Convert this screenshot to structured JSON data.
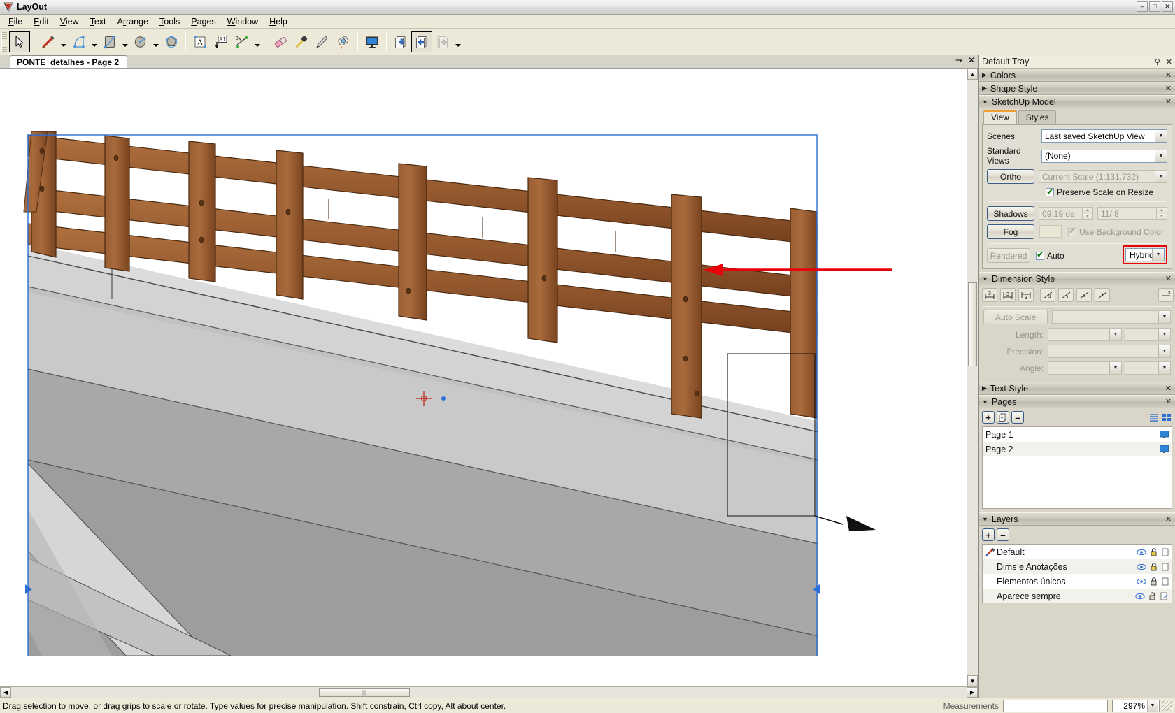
{
  "window": {
    "title": "LayOut",
    "app_icon": "layout-logo-icon",
    "minimize": "–",
    "maximize": "□",
    "close": "✕"
  },
  "menu": [
    {
      "label": "File",
      "accel": "F"
    },
    {
      "label": "Edit",
      "accel": "E"
    },
    {
      "label": "View",
      "accel": "V"
    },
    {
      "label": "Text",
      "accel": "T"
    },
    {
      "label": "Arrange",
      "accel": "A"
    },
    {
      "label": "Tools",
      "accel": "T"
    },
    {
      "label": "Pages",
      "accel": "P"
    },
    {
      "label": "Window",
      "accel": "W"
    },
    {
      "label": "Help",
      "accel": "H"
    }
  ],
  "toolbar": {
    "tools": [
      {
        "name": "select-tool",
        "icon": "cursor-arrow-icon",
        "active": true
      },
      {
        "name": "pencil-tool",
        "icon": "pencil-icon",
        "dropdown": true
      },
      {
        "name": "arc-tool",
        "icon": "arc-icon",
        "dropdown": true
      },
      {
        "name": "rectangle-tool",
        "icon": "rectangle-icon",
        "dropdown": true
      },
      {
        "name": "circle-tool",
        "icon": "circle-icon",
        "dropdown": true
      },
      {
        "name": "polygon-tool",
        "icon": "polygon-icon",
        "dropdown": false
      },
      {
        "name": "text-tool",
        "icon": "text-a-icon"
      },
      {
        "name": "label-tool",
        "icon": "label-a1-icon"
      },
      {
        "name": "dimension-tool",
        "icon": "dimension-icon",
        "dropdown": true
      },
      {
        "name": "eraser-tool",
        "icon": "eraser-icon"
      },
      {
        "name": "eyedropper-tool",
        "icon": "eyedropper-icon"
      },
      {
        "name": "style-tool",
        "icon": "pen-nib-icon"
      },
      {
        "name": "paint-tool",
        "icon": "paint-bucket-icon"
      },
      {
        "name": "presentation-tool",
        "icon": "monitor-icon"
      },
      {
        "name": "add-page",
        "icon": "page-add-icon"
      },
      {
        "name": "previous-page",
        "icon": "page-previous-icon",
        "active": true
      },
      {
        "name": "next-page",
        "icon": "page-next-icon",
        "disabled": true
      }
    ]
  },
  "document": {
    "tab_label": "PONTE_detalhes - Page 2",
    "zoom": "297%"
  },
  "tray": {
    "title": "Default Tray",
    "pin_icon": "pin-icon",
    "close_icon": "close-icon",
    "panels": [
      {
        "name": "colors",
        "label": "Colors",
        "expanded": false
      },
      {
        "name": "shape-style",
        "label": "Shape Style",
        "expanded": false
      },
      {
        "name": "sketchup-model",
        "label": "SketchUp Model",
        "expanded": true
      },
      {
        "name": "dimension-style",
        "label": "Dimension Style",
        "expanded": true
      },
      {
        "name": "text-style",
        "label": "Text Style",
        "expanded": false
      },
      {
        "name": "pages",
        "label": "Pages",
        "expanded": true
      },
      {
        "name": "layers",
        "label": "Layers",
        "expanded": true
      }
    ]
  },
  "sketchup_model": {
    "tabs": [
      {
        "label": "View",
        "active": true
      },
      {
        "label": "Styles",
        "active": false
      }
    ],
    "scenes_label": "Scenes",
    "scenes_value": "Last saved SketchUp View",
    "standard_views_label": "Standard Views",
    "standard_views_value": "(None)",
    "ortho_button": "Ortho",
    "current_scale_value": "Current Scale (1:131.732)",
    "preserve_scale_label": "Preserve Scale on Resize",
    "preserve_scale_checked": true,
    "shadows_button": "Shadows",
    "shadows_time": "09:19 de.",
    "shadows_date": "11/  8",
    "fog_button": "Fog",
    "use_background_label": "Use Background Color",
    "use_background_checked": true,
    "rendered_button": "Rendered",
    "auto_label": "Auto",
    "auto_checked": true,
    "render_mode_value": "Hybrid",
    "highlight_color": "#e8000a"
  },
  "dimension_style": {
    "align_icons": [
      "dim-align-above-icon",
      "dim-align-center-icon",
      "dim-align-below-icon",
      "dim-rotate-horizontal-icon",
      "dim-rotate-aligned-icon",
      "dim-rotate-vertical-icon",
      "dim-rotate-perpendicular-icon",
      "dim-start-arrow-icon"
    ],
    "auto_scale_button": "Auto Scale",
    "length_label": "Length:",
    "precision_label": "Precision:",
    "angle_label": "Angle:"
  },
  "pages": {
    "add_icon": "plus-icon",
    "duplicate_icon": "duplicate-page-icon",
    "remove_icon": "minus-icon",
    "list_view_icon": "list-view-icon",
    "grid_view_icon": "grid-view-icon",
    "items": [
      {
        "name": "Page 1",
        "monitor_icon": "monitor-icon"
      },
      {
        "name": "Page 2",
        "monitor_icon": "monitor-icon"
      }
    ]
  },
  "layers": {
    "add_icon": "plus-icon",
    "remove_icon": "minus-icon",
    "items": [
      {
        "name": "Default",
        "active": true,
        "pencil_icon": "pencil-active-icon",
        "visible_icon": "eye-icon",
        "lock_icon": "unlock-icon",
        "shared_icon": "page-icon"
      },
      {
        "name": "Dims e Anotações",
        "active": false,
        "visible_icon": "eye-icon",
        "lock_icon": "unlock-icon",
        "shared_icon": "page-icon"
      },
      {
        "name": "Elementos únicos",
        "active": false,
        "visible_icon": "eye-icon",
        "lock_icon": "lock-icon",
        "shared_icon": "page-icon"
      },
      {
        "name": "Aparece sempre",
        "active": false,
        "visible_icon": "eye-icon",
        "lock_icon": "lock-icon",
        "shared_icon": "shared-page-icon"
      }
    ]
  },
  "statusbar": {
    "hint": "Drag selection to move, or drag grips to scale or rotate. Type values for precise manipulation. Shift constrain, Ctrl copy, Alt about center.",
    "measurements_label": "Measurements",
    "measurements_value": "",
    "zoom_value": "297%"
  },
  "colors": {
    "timber_light": "#a4673a",
    "timber_dark": "#7c4520",
    "deck_light": "#c9c9c9",
    "deck_mid": "#b0b0b0",
    "deck_dark": "#9a9a9a",
    "selection_blue": "#2a6fd6",
    "annotation_red": "#e8000a"
  }
}
